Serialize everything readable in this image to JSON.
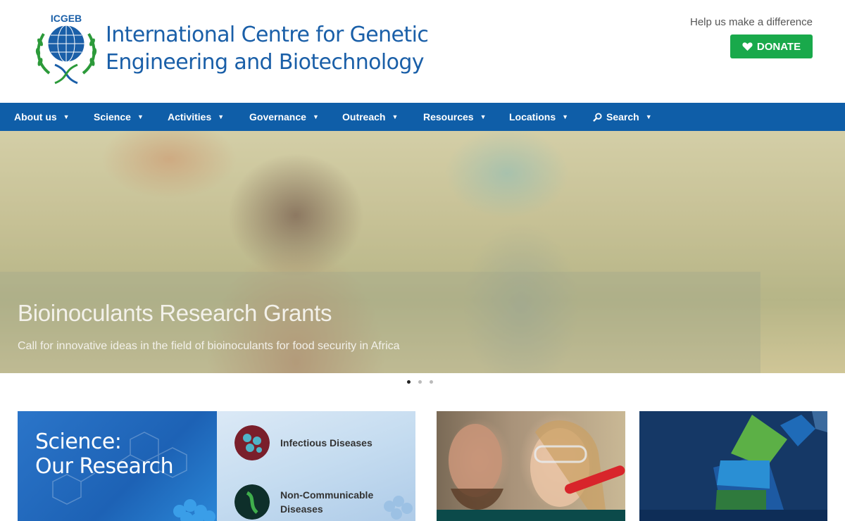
{
  "header": {
    "logo_text": "ICGEB",
    "org_name_line1": "International Centre for Genetic",
    "org_name_line2": "Engineering and Biotechnology",
    "help_text": "Help us make a difference",
    "donate_label": "DONATE"
  },
  "nav": {
    "items": [
      {
        "label": "About us"
      },
      {
        "label": "Science"
      },
      {
        "label": "Activities"
      },
      {
        "label": "Governance"
      },
      {
        "label": "Outreach"
      },
      {
        "label": "Resources"
      },
      {
        "label": "Locations"
      },
      {
        "label": "Search"
      }
    ]
  },
  "hero": {
    "title": "Bioinoculants Research Grants",
    "subtitle": "Call for innovative ideas in the field of bioinoculants for food security in Africa",
    "slide_count": 3,
    "active_slide": 1
  },
  "science_card": {
    "title_line1": "Science:",
    "title_line2": "Our Research",
    "items": [
      {
        "label": "Infectious Diseases"
      },
      {
        "label": "Non-Communicable Diseases"
      }
    ]
  },
  "colors": {
    "brand_blue": "#1a5fa8",
    "nav_blue": "#0f5ea8",
    "donate_green": "#19a94b"
  }
}
